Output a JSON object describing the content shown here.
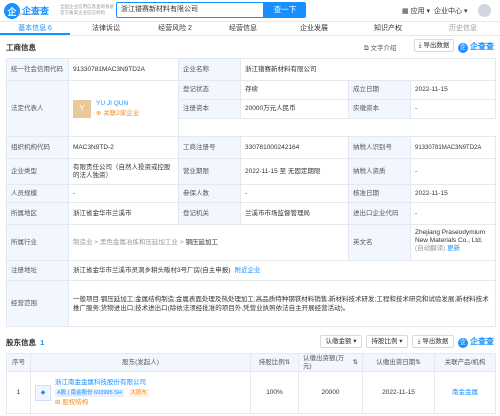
{
  "header": {
    "logo_mark": "企",
    "logo_text": "企查查",
    "logo_sub": "Qcc.com",
    "slogan_line1": "全国企业信用信息查询系统",
    "slogan_line2": "官方备案企业征信机构",
    "search_value": "浙江镨赛新材料有限公司",
    "search_button": "查一下",
    "nav_app": "应用",
    "nav_center": "企业中心"
  },
  "tabs": [
    {
      "label": "基本信息 6"
    },
    {
      "label": "法律诉讼"
    },
    {
      "label": "经营风险 2"
    },
    {
      "label": "经营信息"
    },
    {
      "label": "企业发展"
    },
    {
      "label": "知识产权"
    },
    {
      "label": "历史信息"
    }
  ],
  "business": {
    "title": "工商信息",
    "copy_text": "文字介绍",
    "export": "导出数据",
    "watermark": "企查查"
  },
  "info": {
    "credit_code_label": "统一社会信用代码",
    "credit_code": "91330781MAC3N9TD2A",
    "company_name_label": "企业名称",
    "company_name": "浙江镨赛新材料有限公司",
    "legal_rep_label": "法定代表人",
    "legal_rep_avatar": "Y",
    "legal_rep_name": "YU JI QUN",
    "legal_rep_link": "关联2家企业",
    "reg_status_label": "登记状态",
    "reg_status": "存续",
    "established_label": "成立日期",
    "established": "2022-11-15",
    "reg_capital_label": "注册资本",
    "reg_capital": "20000万元人民币",
    "paid_capital_label": "实缴资本",
    "paid_capital": "-",
    "org_code_label": "组织机构代码",
    "org_code": "MAC3N9TD-2",
    "biz_reg_label": "工商注册号",
    "biz_reg": "330781000242164",
    "taxpayer_id_label": "纳税人识别号",
    "taxpayer_id": "91330781MAC3N9TD2A",
    "company_type_label": "企业类型",
    "company_type": "有限责任公司（自然人投资或控股的法人独资）",
    "term_label": "营业期限",
    "term": "2022-11-15 至 无固定期限",
    "taxpayer_qual_label": "纳税人资质",
    "taxpayer_qual": "-",
    "staff_label": "人员规模",
    "staff": "-",
    "insured_label": "参保人数",
    "insured": "-",
    "approval_label": "核准日期",
    "approval": "2022-11-15",
    "region_label": "所属地区",
    "region": "浙江省金华市兰溪市",
    "authority_label": "登记机关",
    "authority": "兰溪市市场监督管理局",
    "import_export_label": "进出口企业代码",
    "import_export": "-",
    "industry_label": "所属行业",
    "industry_path": "制造业 > 黑色金属冶炼和压延加工业 >",
    "industry_last": "钢压延加工",
    "english_label": "英文名",
    "english_name": "Zhejiang Praseodymium New Materials Co., Ltd.",
    "english_note": "(自动翻译)",
    "english_update": "更新",
    "address_label": "注册地址",
    "address": "浙江省金华市兰溪市灵洞乡耕头畈村3号厂房(自主申报)",
    "address_link": "附近企业",
    "scope_label": "经营范围",
    "scope": "一般项目:钢压延加工;金属结构制造;金属表面处理及热处理加工;高品质特种钢铁材料销售;新材料技术研发;工程和技术研究和试验发展;新材料技术推广服务;货物进出口;技术进出口(除依法须经批准的项目外,凭营业执照依法自主开展经营活动)。"
  },
  "shareholders": {
    "title": "股东信息",
    "count": "1",
    "filter1": "认缴金额",
    "filter2": "持股比例",
    "export": "导出数据",
    "watermark": "企查查",
    "col_no": "序号",
    "col_name": "股东(发起人)",
    "col_ratio": "持股比例",
    "col_amount": "认缴出资额(万元)",
    "col_date": "认缴出资日期",
    "col_product": "关联产品/机构",
    "rows": [
      {
        "no": "1",
        "name": "浙江南金金属科技股份有限公司",
        "tag1": "A股 | 南金股份 603995.SH",
        "tag2": "大股东",
        "link": "股权结构",
        "ratio": "100%",
        "amount": "20000",
        "date": "2022-11-15",
        "product": "南金金属"
      }
    ]
  },
  "colors": {
    "accent": "#1890ff",
    "label_bg": "#f2f7ff",
    "border": "#e4e9f0"
  }
}
